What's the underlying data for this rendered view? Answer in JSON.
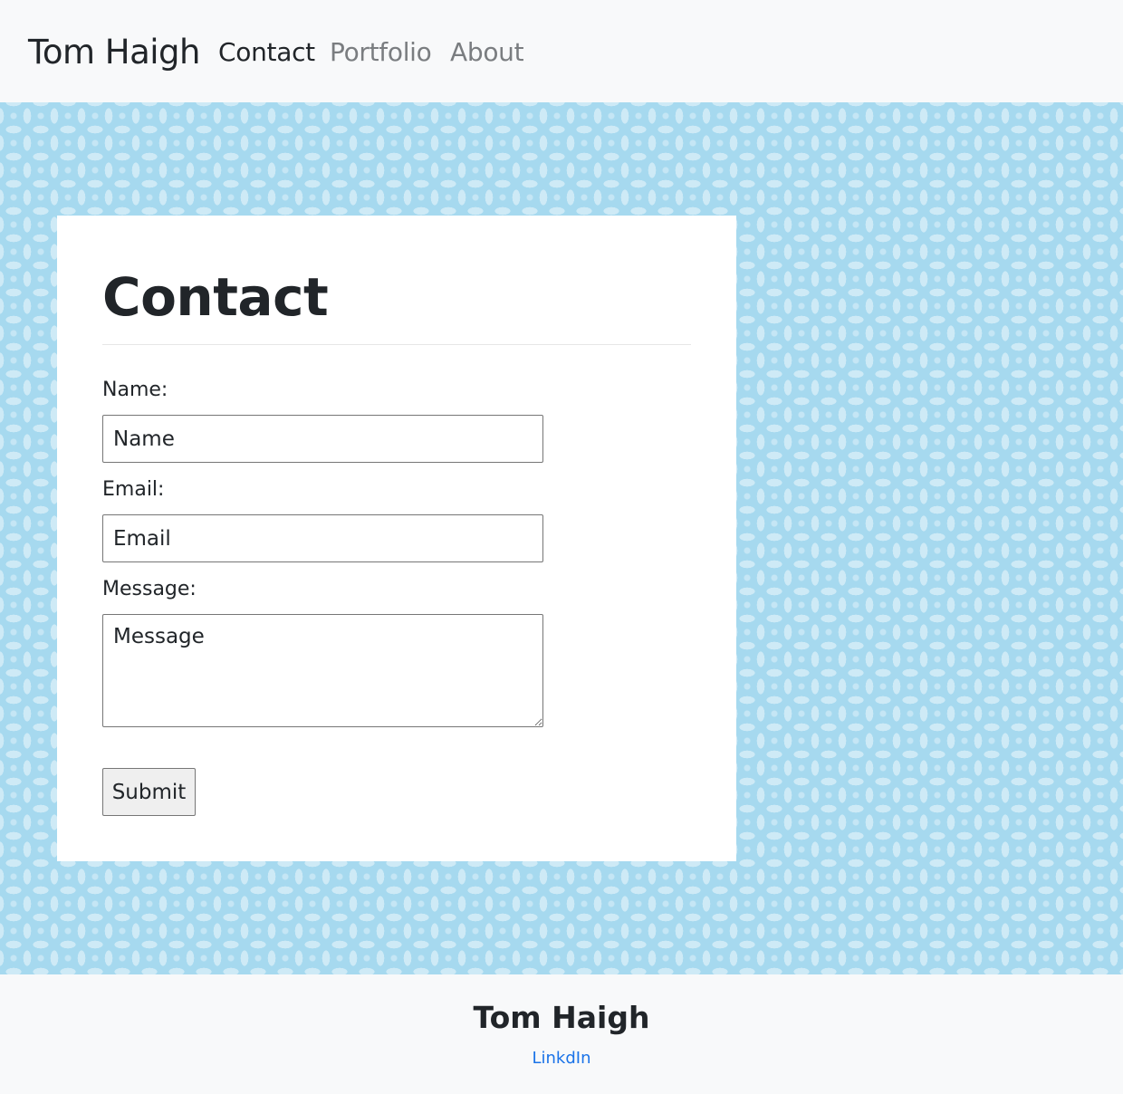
{
  "navbar": {
    "brand": "Tom Haigh",
    "links": [
      {
        "label": "Contact",
        "active": true
      },
      {
        "label": "Portfolio",
        "active": false
      },
      {
        "label": "About",
        "active": false
      }
    ]
  },
  "main": {
    "title": "Contact",
    "form": {
      "name_label": "Name:",
      "name_placeholder": "Name",
      "email_label": "Email:",
      "email_placeholder": "Email",
      "message_label": "Message:",
      "message_placeholder": "Message",
      "submit_label": "Submit"
    }
  },
  "footer": {
    "name": "Tom Haigh",
    "link_label": "LinkdIn"
  },
  "colors": {
    "background_pattern": "#a6d9ef",
    "navbar_bg": "#f8f9fa",
    "link_blue": "#1a73e8"
  }
}
